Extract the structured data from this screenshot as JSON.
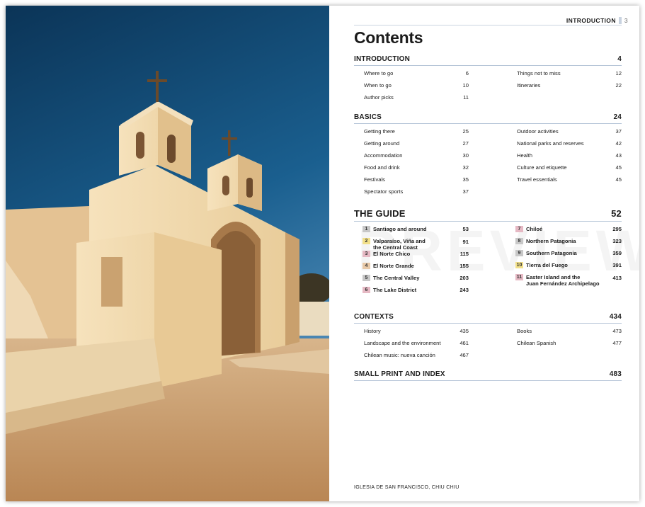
{
  "running_head": {
    "label": "INTRODUCTION",
    "page": "3"
  },
  "title": "Contents",
  "watermark": "PREVIEW VERSION",
  "sections": {
    "introduction": {
      "title": "INTRODUCTION",
      "page": "4",
      "left": [
        {
          "label": "Where to go",
          "page": "6"
        },
        {
          "label": "When to go",
          "page": "10"
        },
        {
          "label": "Author picks",
          "page": "11"
        }
      ],
      "right": [
        {
          "label": "Things not to miss",
          "page": "12"
        },
        {
          "label": "Itineraries",
          "page": "22"
        }
      ]
    },
    "basics": {
      "title": "BASICS",
      "page": "24",
      "left": [
        {
          "label": "Getting there",
          "page": "25"
        },
        {
          "label": "Getting around",
          "page": "27"
        },
        {
          "label": "Accommodation",
          "page": "30"
        },
        {
          "label": "Food and drink",
          "page": "32"
        },
        {
          "label": "Festivals",
          "page": "35"
        },
        {
          "label": "Spectator sports",
          "page": "37"
        }
      ],
      "right": [
        {
          "label": "Outdoor activities",
          "page": "37"
        },
        {
          "label": "National parks and reserves",
          "page": "42"
        },
        {
          "label": "Health",
          "page": "43"
        },
        {
          "label": "Culture and etiquette",
          "page": "45"
        },
        {
          "label": "Travel essentials",
          "page": "45"
        }
      ]
    },
    "guide": {
      "title": "THE GUIDE",
      "page": "52",
      "left": [
        {
          "num": "1",
          "label": "Santiago and around",
          "page": "53",
          "color": "#c8c8c8"
        },
        {
          "num": "2",
          "label": "Valparaíso, Viña and\nthe Central Coast",
          "page": "91",
          "color": "#f2e08a"
        },
        {
          "num": "3",
          "label": "El Norte Chico",
          "page": "115",
          "color": "#e6b9c4"
        },
        {
          "num": "4",
          "label": "El Norte Grande",
          "page": "155",
          "color": "#e8c9a8"
        },
        {
          "num": "5",
          "label": "The Central Valley",
          "page": "203",
          "color": "#c8c8c8"
        },
        {
          "num": "6",
          "label": "The Lake District",
          "page": "243",
          "color": "#e6b9c4"
        }
      ],
      "right": [
        {
          "num": "7",
          "label": "Chiloé",
          "page": "295",
          "color": "#e6b9c4"
        },
        {
          "num": "8",
          "label": "Northern Patagonia",
          "page": "323",
          "color": "#c8c8c8"
        },
        {
          "num": "9",
          "label": "Southern Patagonia",
          "page": "359",
          "color": "#c8c8c8"
        },
        {
          "num": "10",
          "label": "Tierra del Fuego",
          "page": "391",
          "color": "#f2e08a"
        },
        {
          "num": "11",
          "label": "Easter Island and the\nJuan Fernández Archipelago",
          "page": "413",
          "color": "#e6b9c4"
        }
      ]
    },
    "contexts": {
      "title": "CONTEXTS",
      "page": "434",
      "left": [
        {
          "label": "History",
          "page": "435"
        },
        {
          "label": "Landscape and the environment",
          "page": "461"
        },
        {
          "label": "Chilean music: nueva canción",
          "page": "467"
        }
      ],
      "right": [
        {
          "label": "Books",
          "page": "473"
        },
        {
          "label": "Chilean Spanish",
          "page": "477"
        }
      ]
    },
    "small_print": {
      "title": "SMALL PRINT AND INDEX",
      "page": "483"
    }
  },
  "caption": "IGLESIA DE SAN FRANCISCO, CHIU CHIU",
  "colors": {
    "sky": "#0d3a64",
    "church": "#efd7a8",
    "ground": "#c79a6b",
    "rule": "#b7c6d8"
  }
}
